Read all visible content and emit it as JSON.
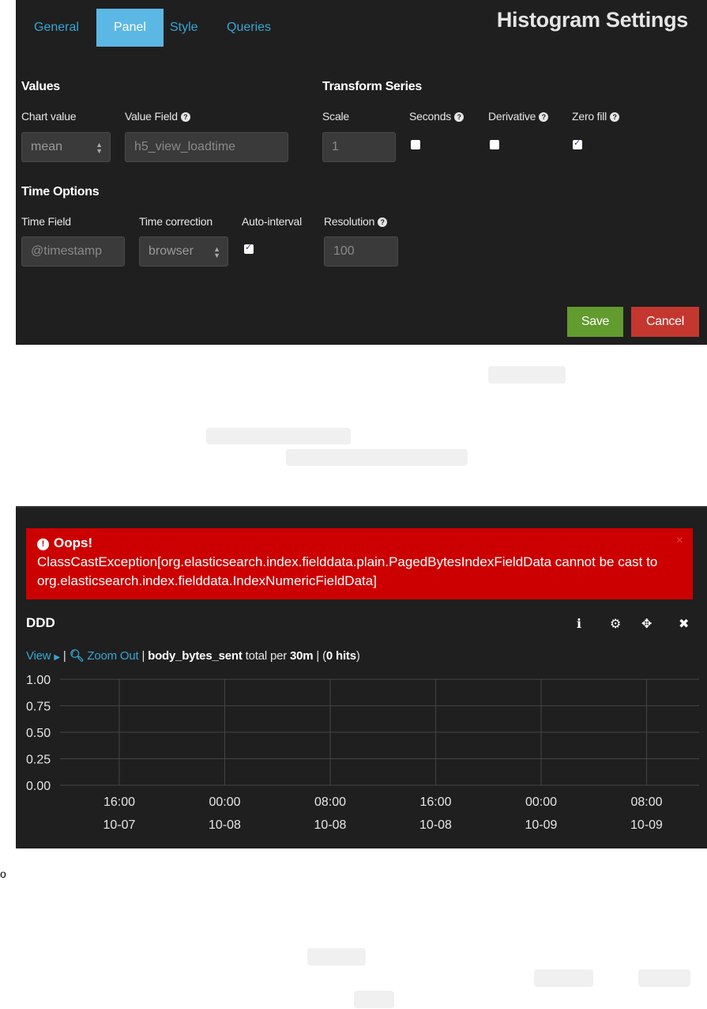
{
  "settings": {
    "tabs": [
      {
        "label": "General",
        "active": false
      },
      {
        "label": "Panel",
        "active": true
      },
      {
        "label": "Style",
        "active": false
      },
      {
        "label": "Queries",
        "active": false
      }
    ],
    "title": "Histogram Settings",
    "values_section": {
      "heading": "Values",
      "chart_value_label": "Chart value",
      "chart_value": "mean",
      "value_field_label": "Value Field",
      "value_field": "h5_view_loadtime"
    },
    "transform_section": {
      "heading": "Transform Series",
      "scale_label": "Scale",
      "scale": "1",
      "seconds_label": "Seconds",
      "seconds_checked": false,
      "derivative_label": "Derivative",
      "derivative_checked": false,
      "zero_fill_label": "Zero fill",
      "zero_fill_checked": true
    },
    "time_section": {
      "heading": "Time Options",
      "time_field_label": "Time Field",
      "time_field": "@timestamp",
      "time_correction_label": "Time correction",
      "time_correction": "browser",
      "auto_interval_label": "Auto-interval",
      "auto_interval_checked": true,
      "resolution_label": "Resolution",
      "resolution": "100"
    },
    "save_label": "Save",
    "cancel_label": "Cancel"
  },
  "panel": {
    "error_title": "Oops!",
    "error_message": "ClassCastException[org.elasticsearch.index.fielddata.plain.PagedBytesIndexFieldData cannot be cast to org.elasticsearch.index.fielddata.IndexNumericFieldData]",
    "error_close": "×",
    "title": "DDD",
    "toolbar": {
      "view": "View",
      "zoom_out": "Zoom Out",
      "field": "body_bytes_sent",
      "total_per": "total per",
      "interval": "30m",
      "hits_prefix": "| (",
      "hits": "0 hits",
      "hits_suffix": ")"
    }
  },
  "footnote": "o",
  "chart_data": {
    "type": "bar",
    "title": "",
    "xlabel": "",
    "ylabel": "",
    "ylim": [
      0,
      1
    ],
    "yticks": [
      "1.00",
      "0.75",
      "0.50",
      "0.25",
      "0.00"
    ],
    "xticks": [
      {
        "time": "16:00",
        "date": "10-07"
      },
      {
        "time": "00:00",
        "date": "10-08"
      },
      {
        "time": "08:00",
        "date": "10-08"
      },
      {
        "time": "16:00",
        "date": "10-08"
      },
      {
        "time": "00:00",
        "date": "10-09"
      },
      {
        "time": "08:00",
        "date": "10-09"
      }
    ],
    "series": [],
    "grid": true
  }
}
